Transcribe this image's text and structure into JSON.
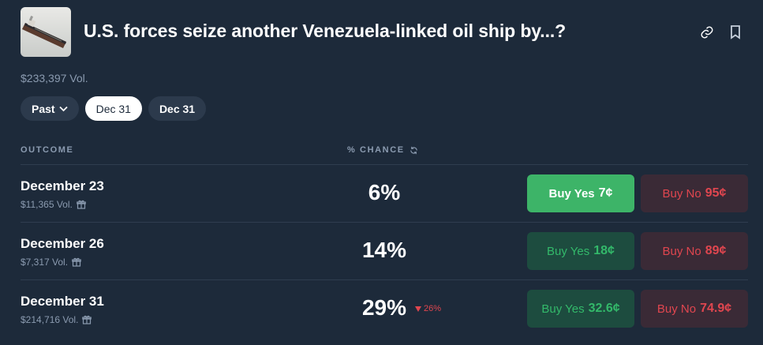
{
  "market": {
    "title": "U.S. forces seize another Venezuela-linked oil ship by...?",
    "volume": "$233,397 Vol."
  },
  "icons": {
    "thumbnail": "oil-tanker-image",
    "link": "link-icon",
    "bookmark": "bookmark-icon",
    "refresh": "refresh-icon",
    "gift": "gift-icon",
    "chevron": "chevron-down-icon",
    "down_arrow": "triangle-down-icon"
  },
  "filters": {
    "past_label": "Past",
    "dates": [
      "Dec 31",
      "Dec 31"
    ],
    "active_index": 0
  },
  "table": {
    "outcome_header": "OUTCOME",
    "chance_header": "% CHANCE"
  },
  "rows": [
    {
      "name": "December 23",
      "volume": "$11,365 Vol.",
      "chance": "6%",
      "delta": "",
      "yes_label": "Buy Yes",
      "yes_price": "7¢",
      "no_label": "Buy No",
      "no_price": "95¢"
    },
    {
      "name": "December 26",
      "volume": "$7,317 Vol.",
      "chance": "14%",
      "delta": "",
      "yes_label": "Buy Yes",
      "yes_price": "18¢",
      "no_label": "Buy No",
      "no_price": "89¢"
    },
    {
      "name": "December 31",
      "volume": "$214,716 Vol.",
      "chance": "29%",
      "delta": "26%",
      "yes_label": "Buy Yes",
      "yes_price": "32.6¢",
      "no_label": "Buy No",
      "no_price": "74.9¢"
    }
  ],
  "colors": {
    "background": "#1d2a3a",
    "yes_green": "#3db468",
    "no_red": "#e0464f",
    "muted": "#8b9bb0"
  }
}
